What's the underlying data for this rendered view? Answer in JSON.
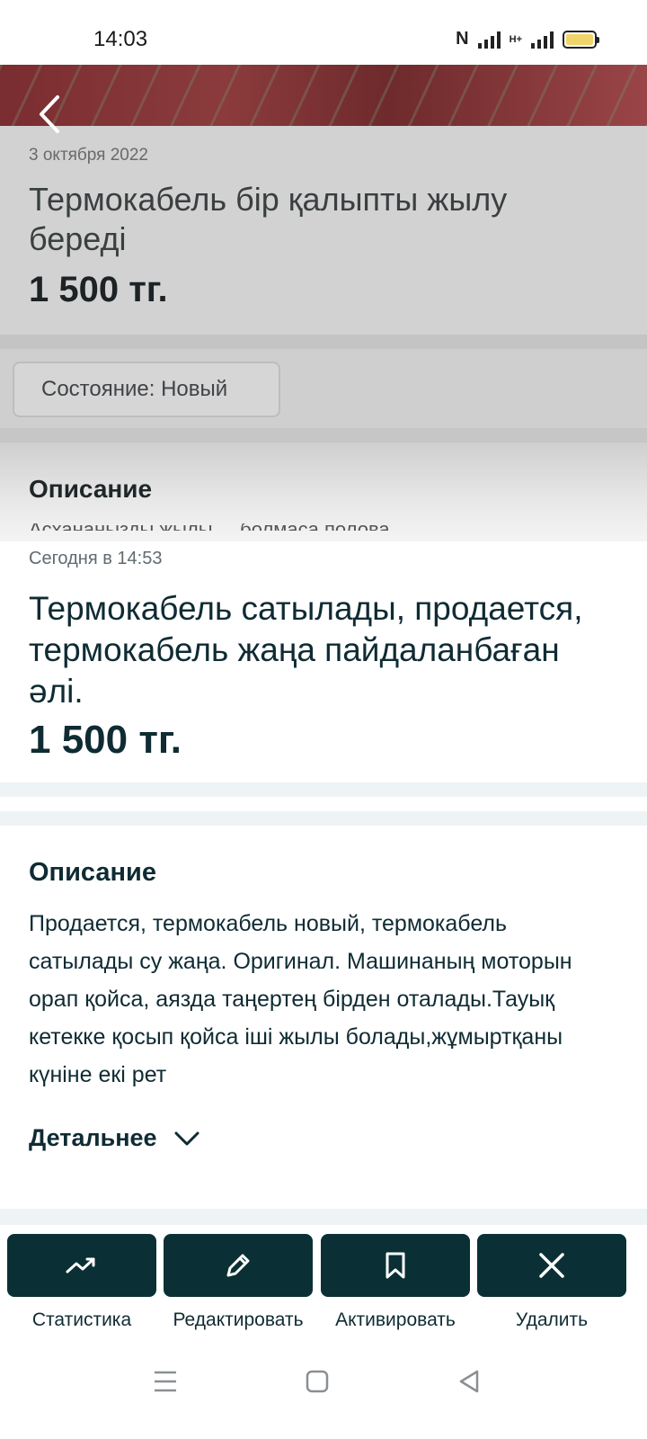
{
  "status_bar": {
    "time": "14:03",
    "network_label": "H+",
    "battery_color": "#f2d56a",
    "icons": [
      "nfc-icon",
      "signal-icon",
      "signal-h-plus-icon",
      "battery-icon"
    ]
  },
  "background_listing": {
    "date": "3 октября 2022",
    "title": "Термокабель бір қалыпты жылу береді",
    "price": "1 500 тг.",
    "condition_chip": "Состояние: Новый",
    "description_heading": "Описание",
    "description_cut": "Асхананызды жылы ... болмаса полова"
  },
  "listing": {
    "date": "Сегодня в 14:53",
    "title": "Термокабель сатылады, продается, термокабель жаңа пайдаланбаған әлі.",
    "price": "1 500 тг."
  },
  "description": {
    "heading": "Описание",
    "text": "Продается, термокабель новый, термокабель сатылады су жаңа. Оригинал. Машинаның моторын орап қойса, аязда таңертең бірден оталады.Тауық кетекке қосып қойса іші жылы болады,жұмыртқаны күніне екі рет",
    "more_label": "Детальнее"
  },
  "actions": [
    {
      "label": "Статистика",
      "icon": "trend-up-icon"
    },
    {
      "label": "Редактировать",
      "icon": "pencil-icon"
    },
    {
      "label": "Активировать",
      "icon": "bookmark-icon"
    },
    {
      "label": "Удалить",
      "icon": "close-icon"
    }
  ],
  "colors": {
    "primary_dark": "#0a3035",
    "text": "#0f2b33",
    "separator": "#eef3f5"
  },
  "navbar": {
    "icons": [
      "menu-icon",
      "home-square-icon",
      "back-triangle-icon"
    ]
  }
}
